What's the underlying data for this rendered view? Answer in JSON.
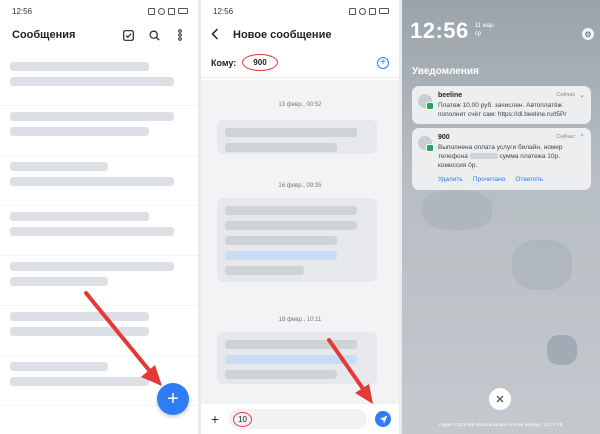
{
  "panel1": {
    "status_time": "12:56",
    "title": "Сообщения",
    "icons": [
      "select-icon",
      "search-icon",
      "more-icon"
    ],
    "fab_label": "+"
  },
  "panel2": {
    "status_time": "12:56",
    "title": "Новое сообщение",
    "to_label": "Кому:",
    "to_value": "900",
    "timestamps": [
      "13 февр., 00:52",
      "16 февр., 09:35",
      "18 февр., 10:11"
    ],
    "input_value": "10"
  },
  "panel3": {
    "time": "12:56",
    "date_line1": "11 мар.",
    "date_line2": "ср",
    "notifications_title": "Уведомления",
    "notifications": [
      {
        "sender": "beeline",
        "time": "Сейчас",
        "body": "Платеж 10,00 руб. зачислен. Автоплатёж пополнит счёт сам: https://dl.beeline.ru/t5Pr"
      },
      {
        "sender": "900",
        "time": "Сейчас",
        "body_start": "Выполнена оплата услуги билайн, номер телефона",
        "body_mid": "сумма платежа 10р. комиссия 0р.",
        "actions": [
          "Удалить",
          "Прочитано",
          "Ответить"
        ]
      }
    ],
    "storage_text": "годня: 220,9 МБ Использовано в этом месяце: 32,74 ГБ"
  },
  "colors": {
    "accent": "#2e7cf6",
    "highlight": "#e53935"
  }
}
